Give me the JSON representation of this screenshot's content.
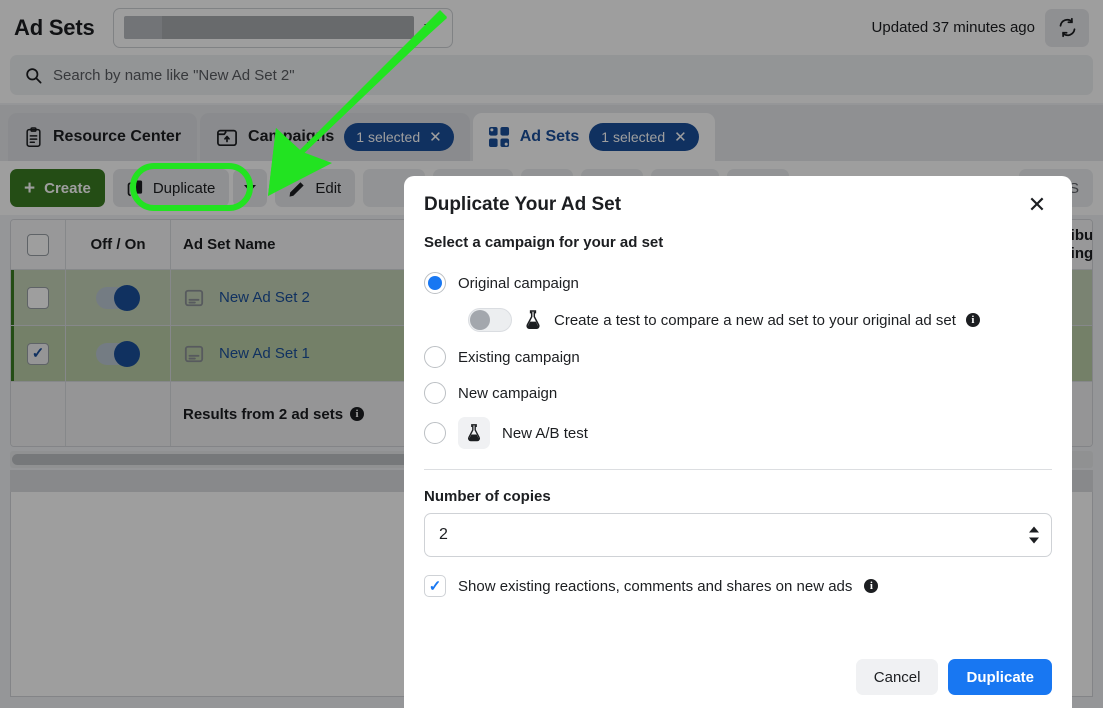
{
  "header": {
    "title": "Ad Sets",
    "account_selector_value": "",
    "account_selector_redacted": true,
    "updated_text": "Updated 37 minutes ago",
    "refresh_icon": "refresh-icon",
    "caret_icon": "chevron-down-icon"
  },
  "search": {
    "icon": "search-icon",
    "placeholder": "Search by name like \"New Ad Set 2\""
  },
  "tabs": [
    {
      "label": "Resource Center",
      "icon": "clipboard-icon",
      "active": false,
      "badge": null
    },
    {
      "label": "Campaigns",
      "icon": "folder-up-icon",
      "active": false,
      "badge": "1 selected",
      "badge_close": "✕"
    },
    {
      "label": "Ad Sets",
      "icon": "grid-squares-icon",
      "active": true,
      "badge": "1 selected",
      "badge_close": "✕"
    }
  ],
  "toolbar": {
    "create_label": "Create",
    "create_icon": "plus-icon",
    "duplicate_label": "Duplicate",
    "duplicate_icon": "copy-icon",
    "duplicate_caret_icon": "chevron-down-icon",
    "edit_label": "Edit",
    "edit_icon": "pencil-icon",
    "view_setup_label": "View S"
  },
  "table": {
    "columns": [
      "",
      "Off / On",
      "Ad Set Name",
      "Attribution setting"
    ],
    "attribution_header_line1": "Attribution",
    "attribution_header_line2": "setting",
    "header_checkbox_checked": false,
    "rows": [
      {
        "checked": false,
        "toggle": "on",
        "icon": "adset-icon",
        "name": "New Ad Set 2"
      },
      {
        "checked": true,
        "toggle": "on",
        "icon": "adset-icon",
        "name": "New Ad Set 1"
      }
    ],
    "total_row_label": "Results from 2 ad sets",
    "total_row_info_icon": "info-icon"
  },
  "modal": {
    "title": "Duplicate Your Ad Set",
    "close_icon": "close-icon",
    "section_label": "Select a campaign for your ad set",
    "options": [
      {
        "label": "Original campaign",
        "selected": true,
        "icon": null
      },
      {
        "label": "Existing campaign",
        "selected": false,
        "icon": null
      },
      {
        "label": "New campaign",
        "selected": false,
        "icon": null
      },
      {
        "label": "New A/B test",
        "selected": false,
        "icon": "flask-icon"
      }
    ],
    "ab_toggle": {
      "state": "off",
      "icon": "flask-icon",
      "label": "Create a test to compare a new ad set to your original ad set",
      "info_icon": "info-icon"
    },
    "copies_label": "Number of copies",
    "copies_value": "2",
    "copies_spinner_up": "spinner-up-icon",
    "copies_spinner_down": "spinner-down-icon",
    "show_reactions": {
      "checked": true,
      "label": "Show existing reactions, comments and shares on new ads",
      "info_icon": "info-icon"
    },
    "cancel_label": "Cancel",
    "confirm_label": "Duplicate"
  },
  "annotation": {
    "highlight_color": "#22e321",
    "arrow_color": "#22e321",
    "highlight_target": "duplicate-button",
    "arrow_target": "duplicate-button"
  },
  "colors": {
    "brand_blue": "#1877f2",
    "tab_blue": "#1b4f9c",
    "create_green": "#3a7d22",
    "row_highlight_green": "#c6d4b8",
    "annotation_green": "#22e321"
  }
}
